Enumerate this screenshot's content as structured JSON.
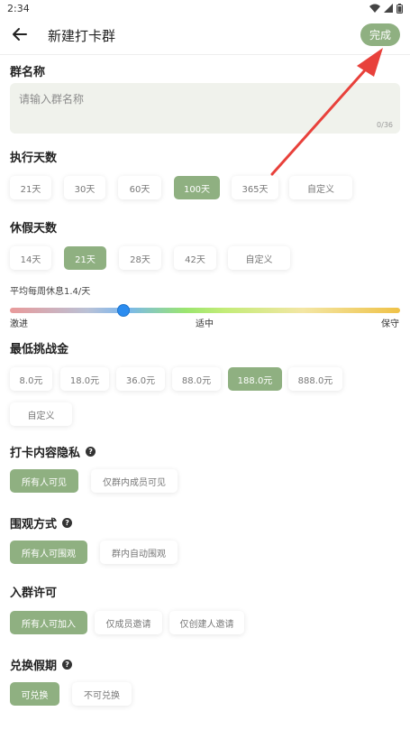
{
  "status_bar": {
    "time": "2:34"
  },
  "header": {
    "title": "新建打卡群",
    "done_label": "完成"
  },
  "group_name": {
    "label": "群名称",
    "placeholder": "请输入群名称",
    "counter": "0/36"
  },
  "exec_days": {
    "label": "执行天数",
    "options": [
      "21天",
      "30天",
      "60天",
      "100天",
      "365天",
      "自定义"
    ],
    "selected": "100天"
  },
  "rest_days": {
    "label": "休假天数",
    "options": [
      "14天",
      "21天",
      "28天",
      "42天",
      "自定义"
    ],
    "selected": "21天"
  },
  "weekly_rest": {
    "label": "平均每周休息1.4/天",
    "level_label_left": "激进",
    "level_label_mid": "适中",
    "level_label_right": "保守",
    "level_fraction": 0.29
  },
  "min_deposit": {
    "label": "最低挑战金",
    "options": [
      "8.0元",
      "18.0元",
      "36.0元",
      "88.0元",
      "188.0元",
      "888.0元",
      "自定义"
    ],
    "selected": "188.0元"
  },
  "privacy": {
    "label": "打卡内容隐私",
    "options": [
      "所有人可见",
      "仅群内成员可见"
    ],
    "selected": "所有人可见"
  },
  "watch_mode": {
    "label": "围观方式",
    "options": [
      "所有人可围观",
      "群内自动围观"
    ],
    "selected": "所有人可围观"
  },
  "join_permission": {
    "label": "入群许可",
    "options": [
      "所有人可加入",
      "仅成员邀请",
      "仅创建人邀请"
    ],
    "selected": "所有人可加入"
  },
  "exchange_leave": {
    "label": "兑换假期",
    "options": [
      "可兑换",
      "不可兑换"
    ],
    "selected": "可兑换"
  },
  "colors": {
    "accent": "#8fb081",
    "slider_thumb": "#2b8cf0",
    "annotation_arrow": "#e8413b"
  },
  "icons": [
    "back-arrow-icon",
    "help-icon",
    "wifi-icon",
    "signal-icon",
    "battery-icon"
  ]
}
